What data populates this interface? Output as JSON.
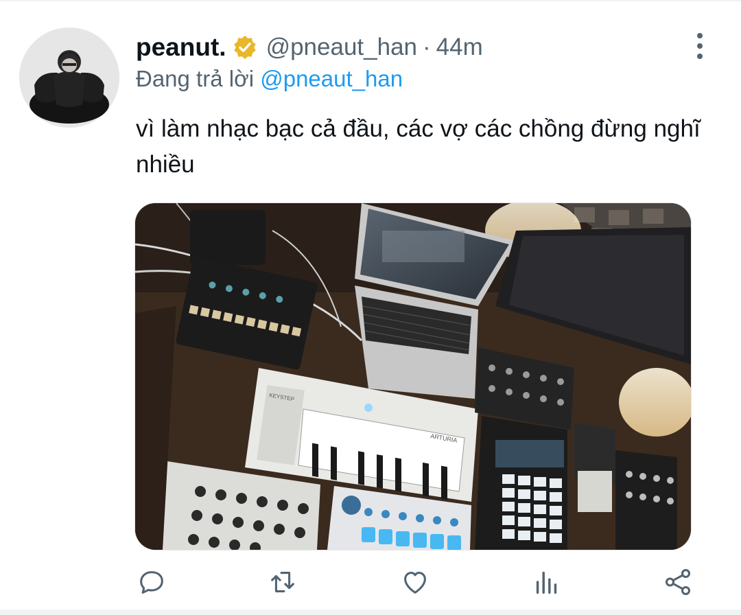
{
  "tweet": {
    "author": {
      "display_name": "peanut.",
      "handle": "@pneaut_han",
      "verified": true,
      "verified_badge_color": "#e8b72a",
      "avatar_icon": "profile-photo"
    },
    "separator": "·",
    "time": "44m",
    "replying": {
      "prefix": "Đang trả lời",
      "mention": "@pneaut_han"
    },
    "text": "vì làm nhạc bạc cả đầu, các vợ các chồng đừng nghĩ nhiều",
    "media": {
      "icon": "studio-photo",
      "brand_labels": [
        "KEYSTEP",
        "ARTURIA"
      ]
    },
    "actions": [
      {
        "name": "reply",
        "icon": "reply-icon"
      },
      {
        "name": "retweet",
        "icon": "retweet-icon"
      },
      {
        "name": "like",
        "icon": "heart-icon"
      },
      {
        "name": "views",
        "icon": "analytics-icon"
      },
      {
        "name": "share",
        "icon": "share-icon"
      }
    ],
    "more_icon": "more-vertical-icon"
  },
  "colors": {
    "text_primary": "#0f1419",
    "text_secondary": "#536471",
    "link": "#1d9bf0",
    "icon": "#536471"
  }
}
